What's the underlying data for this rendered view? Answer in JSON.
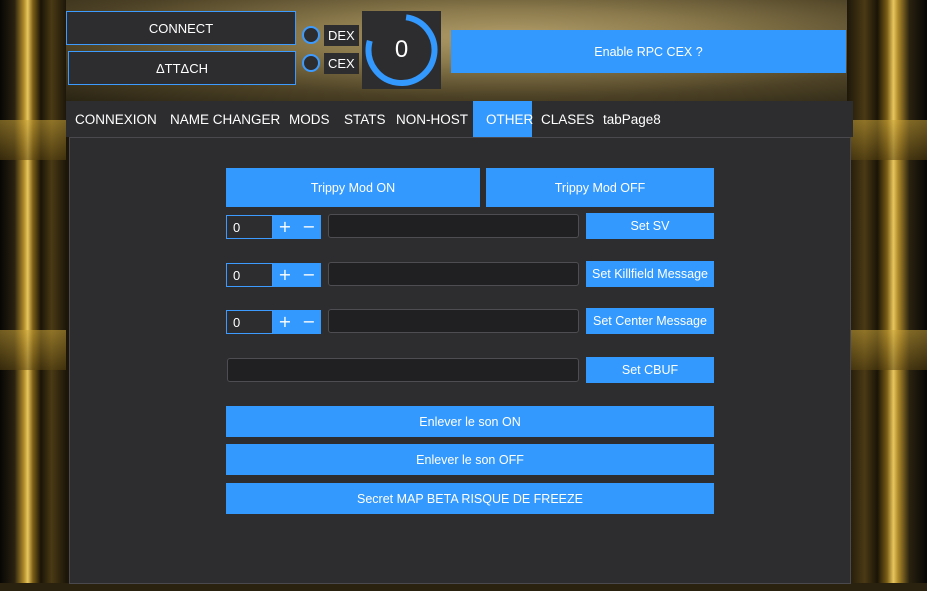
{
  "header": {
    "connect_label": "CONNECT",
    "attach_label": "ΔTTΔCH",
    "dex_label": "DEX",
    "cex_label": "CEX",
    "gauge_value": "0",
    "rpc_label": "Enable RPC CEX ?"
  },
  "tabs": [
    {
      "label": "CONNEXION"
    },
    {
      "label": "NAME CHANGER"
    },
    {
      "label": "MODS"
    },
    {
      "label": "STATS"
    },
    {
      "label": "NON-HOST"
    },
    {
      "label": "OTHER",
      "active": true
    },
    {
      "label": "CLASES"
    },
    {
      "label": "tabPage8"
    }
  ],
  "other": {
    "trippy_on": "Trippy Mod ON",
    "trippy_off": "Trippy Mod OFF",
    "sv": {
      "value": "0",
      "button": "Set SV"
    },
    "killfield": {
      "value": "0",
      "button": "Set Killfield Message"
    },
    "center": {
      "value": "0",
      "button": "Set Center Message"
    },
    "cbuf": {
      "button": "Set CBUF"
    },
    "sound_on": "Enlever le son ON",
    "sound_off": "Enlever le son OFF",
    "secret_map": "Secret MAP BETA RISQUE DE FREEZE",
    "plus_glyph": "+",
    "minus_glyph": "−"
  },
  "colors": {
    "accent": "#3399ff",
    "panel": "#2d2d30",
    "border": "#3d9bff"
  }
}
